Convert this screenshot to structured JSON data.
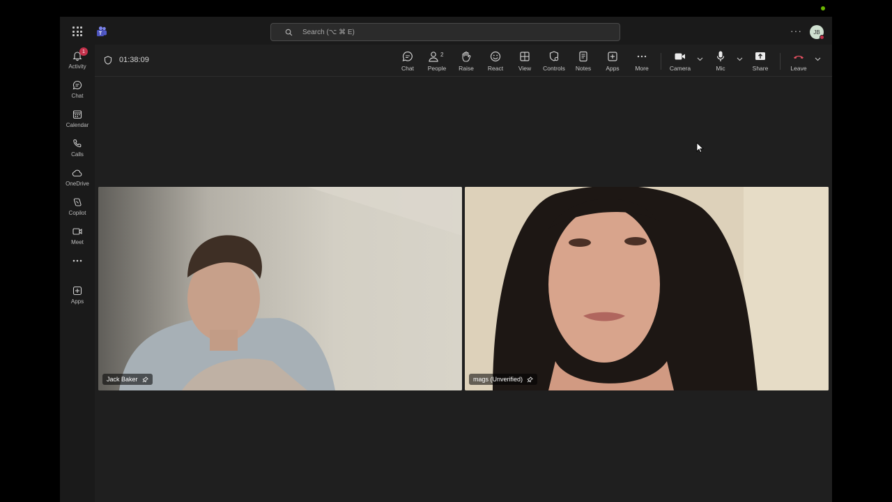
{
  "search": {
    "placeholder": "Search (⌥ ⌘ E)"
  },
  "header": {
    "avatar_initials": "JB",
    "more_label": "···"
  },
  "rail": {
    "items": [
      {
        "label": "Activity",
        "badge": "1",
        "icon": "bell-icon"
      },
      {
        "label": "Chat",
        "icon": "chat-icon"
      },
      {
        "label": "Calendar",
        "icon": "calendar-icon"
      },
      {
        "label": "Calls",
        "icon": "phone-icon"
      },
      {
        "label": "OneDrive",
        "icon": "cloud-icon"
      },
      {
        "label": "Copilot",
        "icon": "copilot-icon"
      },
      {
        "label": "Meet",
        "icon": "video-icon"
      },
      {
        "label": "",
        "icon": "more-icon"
      },
      {
        "label": "Apps",
        "icon": "plus-square-icon"
      }
    ]
  },
  "meeting": {
    "timer": "01:38:09",
    "controls": {
      "chat": "Chat",
      "people": "People",
      "people_count": "2",
      "raise": "Raise",
      "react": "React",
      "view": "View",
      "controls": "Controls",
      "notes": "Notes",
      "apps": "Apps",
      "more": "More",
      "camera": "Camera",
      "mic": "Mic",
      "share": "Share",
      "leave": "Leave"
    }
  },
  "participants": [
    {
      "name": "Jack Baker"
    },
    {
      "name": "mags (Unverified)"
    }
  ],
  "colors": {
    "leave": "#e04f5f",
    "badge": "#c4314b",
    "teams": "#7b83eb",
    "online": "#6bb700"
  }
}
